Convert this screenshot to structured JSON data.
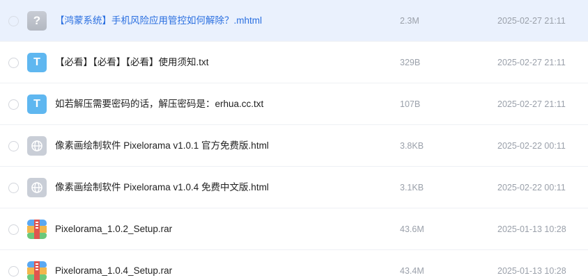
{
  "files": [
    {
      "icon": "unknown-file-icon",
      "glyph": "?",
      "name": "【鸿蒙系统】手机风险应用管控如何解除？.mhtml",
      "size": "2.3M",
      "date": "2025-02-27 21:11",
      "selected": true
    },
    {
      "icon": "txt-file-icon",
      "glyph": "T",
      "name": "【必看】【必看】【必看】使用须知.txt",
      "size": "329B",
      "date": "2025-02-27 21:11",
      "selected": false
    },
    {
      "icon": "txt-file-icon",
      "glyph": "T",
      "name": "如若解压需要密码的话，解压密码是：erhua.cc.txt",
      "size": "107B",
      "date": "2025-02-27 21:11",
      "selected": false
    },
    {
      "icon": "html-file-icon",
      "glyph": "",
      "name": "像素画绘制软件 Pixelorama v1.0.1 官方免费版.html",
      "size": "3.8KB",
      "date": "2025-02-22 00:11",
      "selected": false
    },
    {
      "icon": "html-file-icon",
      "glyph": "",
      "name": "像素画绘制软件 Pixelorama v1.0.4 免费中文版.html",
      "size": "3.1KB",
      "date": "2025-02-22 00:11",
      "selected": false
    },
    {
      "icon": "rar-archive-icon",
      "glyph": "",
      "name": "Pixelorama_1.0.2_Setup.rar",
      "size": "43.6M",
      "date": "2025-01-13 10:28",
      "selected": false
    },
    {
      "icon": "rar-archive-icon",
      "glyph": "",
      "name": "Pixelorama_1.0.4_Setup.rar",
      "size": "43.4M",
      "date": "2025-01-13 10:28",
      "selected": false
    }
  ]
}
